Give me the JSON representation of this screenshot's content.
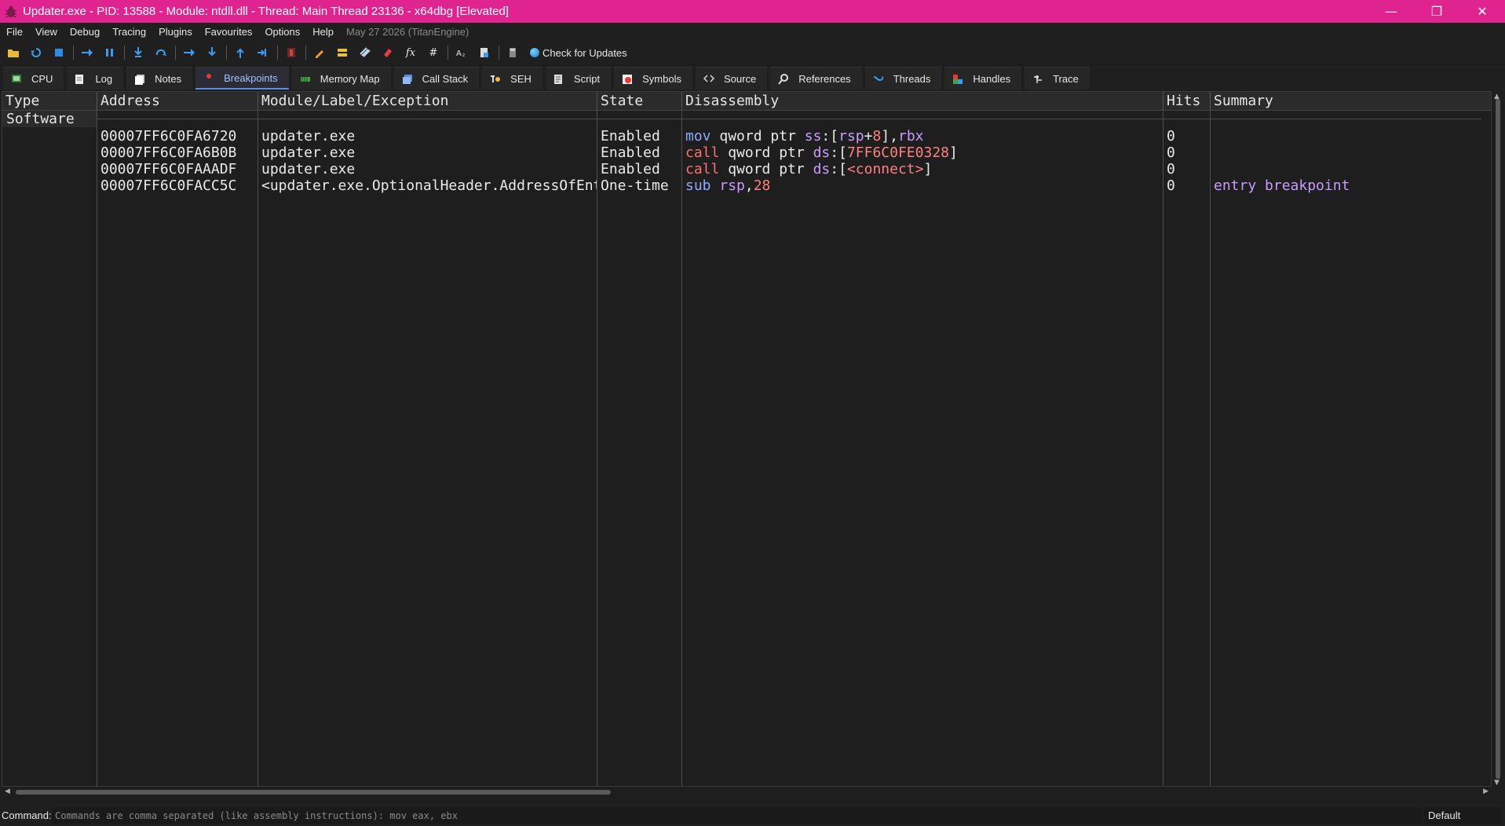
{
  "window": {
    "title": "Updater.exe - PID: 13588 - Module: ntdll.dll - Thread: Main Thread 23136 - x64dbg [Elevated]",
    "minimize": "—",
    "maximize": "❐",
    "close": "✕"
  },
  "menu": {
    "items": [
      "File",
      "View",
      "Debug",
      "Tracing",
      "Plugins",
      "Favourites",
      "Options",
      "Help"
    ],
    "date": "May 27 2026 (TitanEngine)"
  },
  "toolbar": {
    "check_updates": "Check for Updates",
    "fx": "fx",
    "hash": "#"
  },
  "tabs": [
    {
      "label": "CPU",
      "icon": "cpu-icon",
      "active": false
    },
    {
      "label": "Log",
      "icon": "log-icon",
      "active": false
    },
    {
      "label": "Notes",
      "icon": "notes-icon",
      "active": false
    },
    {
      "label": "Breakpoints",
      "icon": "breakpoint-icon",
      "active": true
    },
    {
      "label": "Memory Map",
      "icon": "memory-map-icon",
      "active": false
    },
    {
      "label": "Call Stack",
      "icon": "call-stack-icon",
      "active": false
    },
    {
      "label": "SEH",
      "icon": "seh-icon",
      "active": false
    },
    {
      "label": "Script",
      "icon": "script-icon",
      "active": false
    },
    {
      "label": "Symbols",
      "icon": "symbols-icon",
      "active": false
    },
    {
      "label": "Source",
      "icon": "source-icon",
      "active": false
    },
    {
      "label": "References",
      "icon": "references-icon",
      "active": false
    },
    {
      "label": "Threads",
      "icon": "threads-icon",
      "active": false
    },
    {
      "label": "Handles",
      "icon": "handles-icon",
      "active": false
    },
    {
      "label": "Trace",
      "icon": "trace-icon",
      "active": false
    }
  ],
  "breakpoints": {
    "columns": [
      "Type",
      "Address",
      "Module/Label/Exception",
      "State",
      "Disassembly",
      "Hits",
      "Summary"
    ],
    "group": "Software",
    "rows": [
      {
        "address": "00007FF6C0FA6720",
        "module": "updater.exe",
        "state": "Enabled",
        "dis": {
          "mnemonic": "mov",
          "p1": " qword ptr ",
          "seg": "ss",
          "p2": ":[",
          "reg1": "rsp",
          "op": "+",
          "num": "8",
          "p3": "],",
          "reg2": "rbx"
        },
        "hits": "0",
        "summary": ""
      },
      {
        "address": "00007FF6C0FA6B0B",
        "module": "updater.exe",
        "state": "Enabled",
        "dis": {
          "mnemonic": "call",
          "p1": " qword ptr ",
          "seg": "ds",
          "p2": ":[",
          "target": "7FF6C0FE0328",
          "p3": "]"
        },
        "hits": "0",
        "summary": ""
      },
      {
        "address": "00007FF6C0FAAADF",
        "module": "updater.exe",
        "state": "Enabled",
        "dis": {
          "mnemonic": "call",
          "p1": " qword ptr ",
          "seg": "ds",
          "p2": ":[",
          "target": "<connect>",
          "p3": "]"
        },
        "hits": "0",
        "summary": ""
      },
      {
        "address": "00007FF6C0FACC5C",
        "module": "<updater.exe.OptionalHeader.AddressOfEntryPoint>",
        "state": "One-time",
        "dis": {
          "mnemonic": "sub",
          "reg1": "rsp",
          "p1": ",",
          "num": "28"
        },
        "hits": "0",
        "summary": "entry breakpoint"
      }
    ]
  },
  "command": {
    "label": "Command:",
    "placeholder": "Commands are comma separated (like assembly instructions): mov eax, ebx",
    "mode": "Default"
  }
}
